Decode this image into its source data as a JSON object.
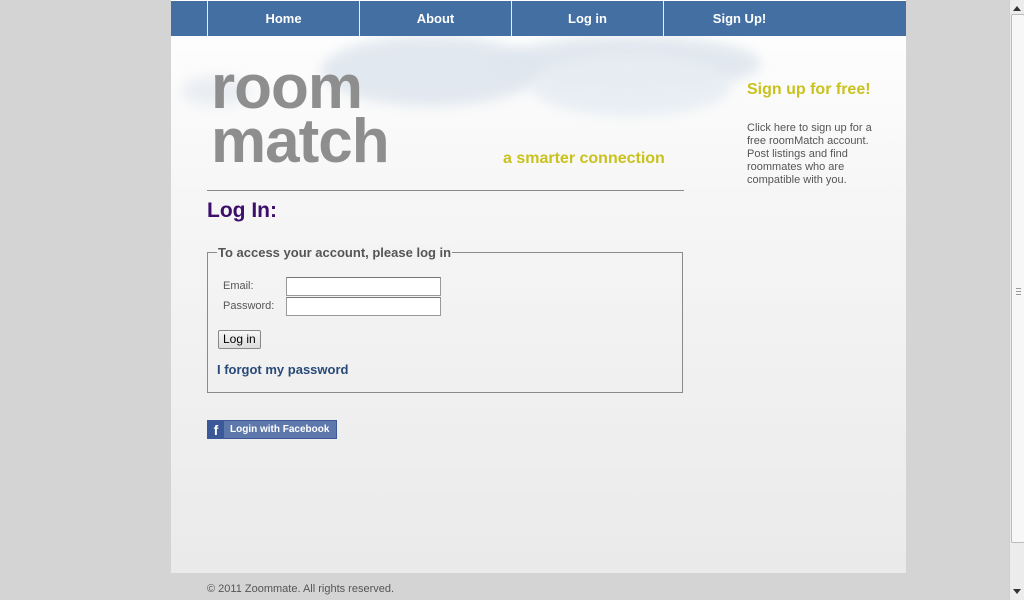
{
  "nav": {
    "items": [
      "Home",
      "About",
      "Log in",
      "Sign Up!"
    ]
  },
  "logo": {
    "line1": "room",
    "line2": "match",
    "text": "roommatch"
  },
  "tagline": "a smarter connection",
  "page_title": "Log In:",
  "login_form": {
    "legend": "To access your account, please log in",
    "email_label": "Email:",
    "email_value": "",
    "password_label": "Password:",
    "password_value": "",
    "submit_label": "Log in",
    "forgot_link": "I forgot my password"
  },
  "facebook_button": {
    "icon": "f",
    "label": "Login with Facebook"
  },
  "sidebar": {
    "title": "Sign up for free!",
    "text": "Click here to sign up for a free roomMatch account. Post listings and find roommates who are compatible with you."
  },
  "footer": "© 2011 Zoommate. All rights reserved.",
  "colors": {
    "nav_bg": "#436fa3",
    "accent_yellow": "#c9c21e",
    "title_purple": "#3c0f6b",
    "link_blue": "#274a78",
    "facebook_blue": "#3b5998"
  },
  "icons": [
    "facebook-icon",
    "scroll-up-icon",
    "scroll-down-icon"
  ]
}
